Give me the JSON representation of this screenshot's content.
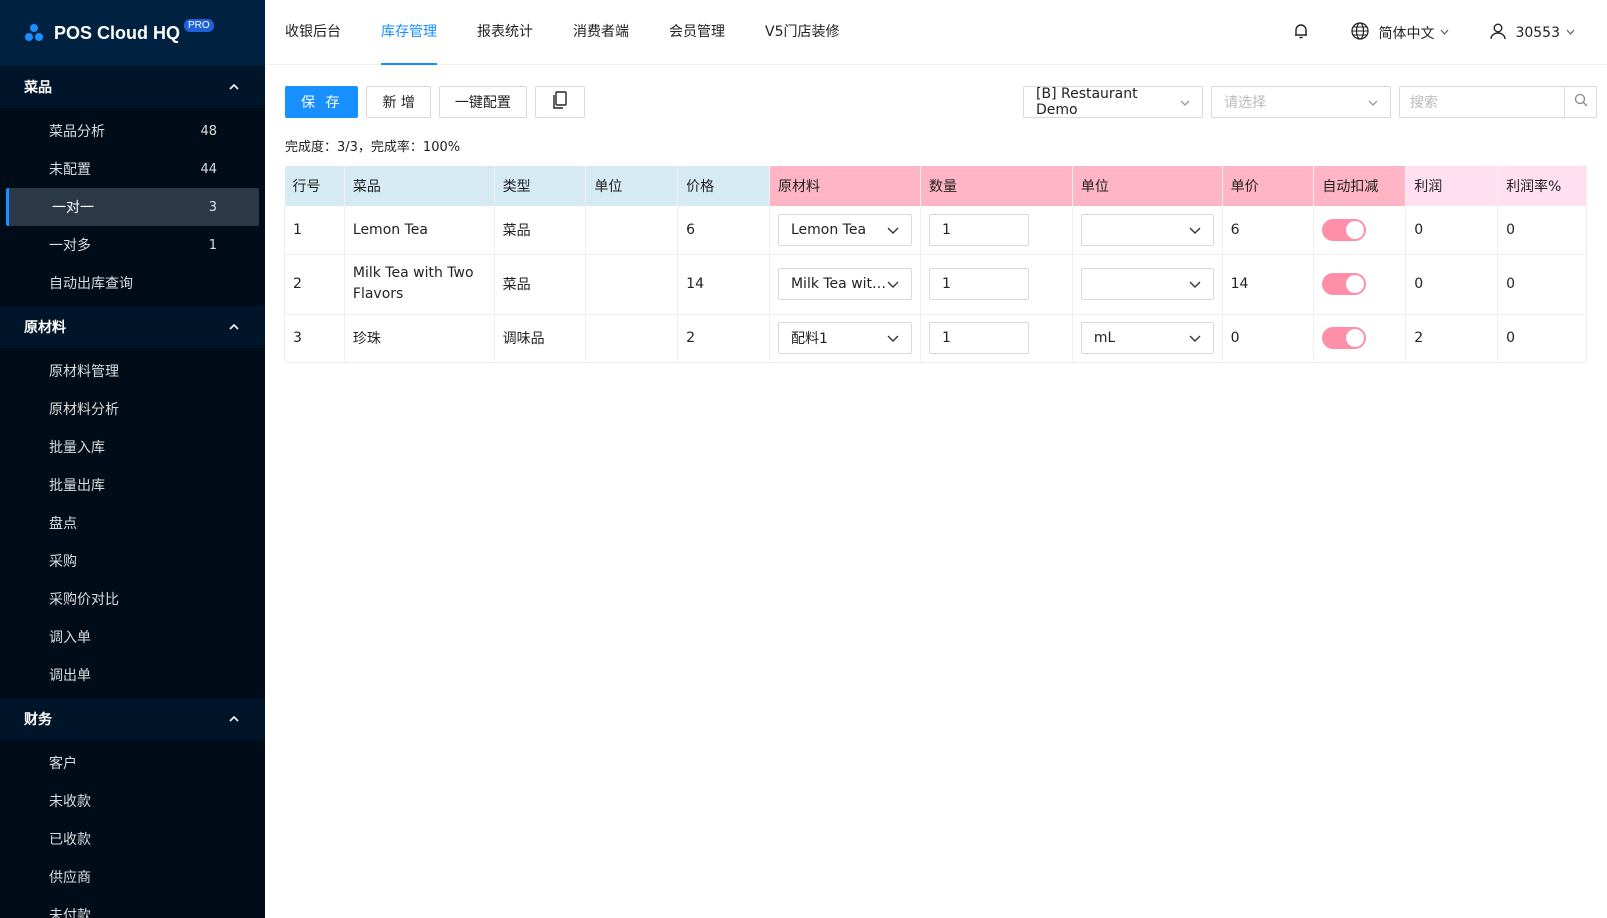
{
  "app": {
    "title": "POS Cloud HQ",
    "badge": "PRO"
  },
  "sidebar": {
    "groups": [
      {
        "label": "菜品",
        "items": [
          {
            "label": "菜品分析",
            "count": "48"
          },
          {
            "label": "未配置",
            "count": "44"
          },
          {
            "label": "一对一",
            "count": "3",
            "active": true
          },
          {
            "label": "一对多",
            "count": "1"
          },
          {
            "label": "自动出库查询",
            "count": ""
          }
        ]
      },
      {
        "label": "原材料",
        "items": [
          {
            "label": "原材料管理"
          },
          {
            "label": "原材料分析"
          },
          {
            "label": "批量入库"
          },
          {
            "label": "批量出库"
          },
          {
            "label": "盘点"
          },
          {
            "label": "采购"
          },
          {
            "label": "采购价对比"
          },
          {
            "label": "调入单"
          },
          {
            "label": "调出单"
          }
        ]
      },
      {
        "label": "财务",
        "items": [
          {
            "label": "客户"
          },
          {
            "label": "未收款"
          },
          {
            "label": "已收款"
          },
          {
            "label": "供应商"
          },
          {
            "label": "未付款"
          }
        ]
      }
    ]
  },
  "topnav": {
    "tabs": [
      "收银后台",
      "库存管理",
      "报表统计",
      "消费者端",
      "会员管理",
      "V5门店装修"
    ],
    "active_tab": "库存管理",
    "language": "简体中文",
    "user": "30553"
  },
  "toolbar": {
    "save": "保 存",
    "add": "新 增",
    "one_click": "一键配置",
    "store_select": "[B] Restaurant Demo",
    "choose_placeholder": "请选择",
    "search_placeholder": "搜索"
  },
  "completion": "完成度：3/3，完成率：100%",
  "table": {
    "headers": [
      "行号",
      "菜品",
      "类型",
      "单位",
      "价格",
      "原材料",
      "数量",
      "单位",
      "单价",
      "自动扣减",
      "利润",
      "利润率%"
    ],
    "rows": [
      {
        "no": "1",
        "dish": "Lemon Tea",
        "type": "菜品",
        "unit": "",
        "price": "6",
        "material": "Lemon Tea",
        "qty": "1",
        "munit": "",
        "unit_price": "6",
        "auto": true,
        "profit": "0",
        "margin": "0"
      },
      {
        "no": "2",
        "dish": "Milk Tea with Two Flavors",
        "type": "菜品",
        "unit": "",
        "price": "14",
        "material": "Milk Tea with…",
        "qty": "1",
        "munit": "",
        "unit_price": "14",
        "auto": true,
        "profit": "0",
        "margin": "0"
      },
      {
        "no": "3",
        "dish": "珍珠",
        "type": "调味品",
        "unit": "",
        "price": "2",
        "material": "配料1",
        "qty": "1",
        "munit": "mL",
        "unit_price": "0",
        "auto": true,
        "profit": "2",
        "margin": "0"
      }
    ]
  },
  "colors": {
    "accent": "#1890ff",
    "sidebar_bg": "#001529",
    "toggle_on": "#ff8fa8",
    "header_blue": "#d6eaf3",
    "header_pink": "#ffb5c5",
    "header_light_pink": "#ffdff0"
  },
  "icons": [
    "bell-icon",
    "globe-icon",
    "user-icon",
    "search-icon",
    "copy-icon",
    "chevron-down-icon",
    "chevron-up-icon"
  ]
}
